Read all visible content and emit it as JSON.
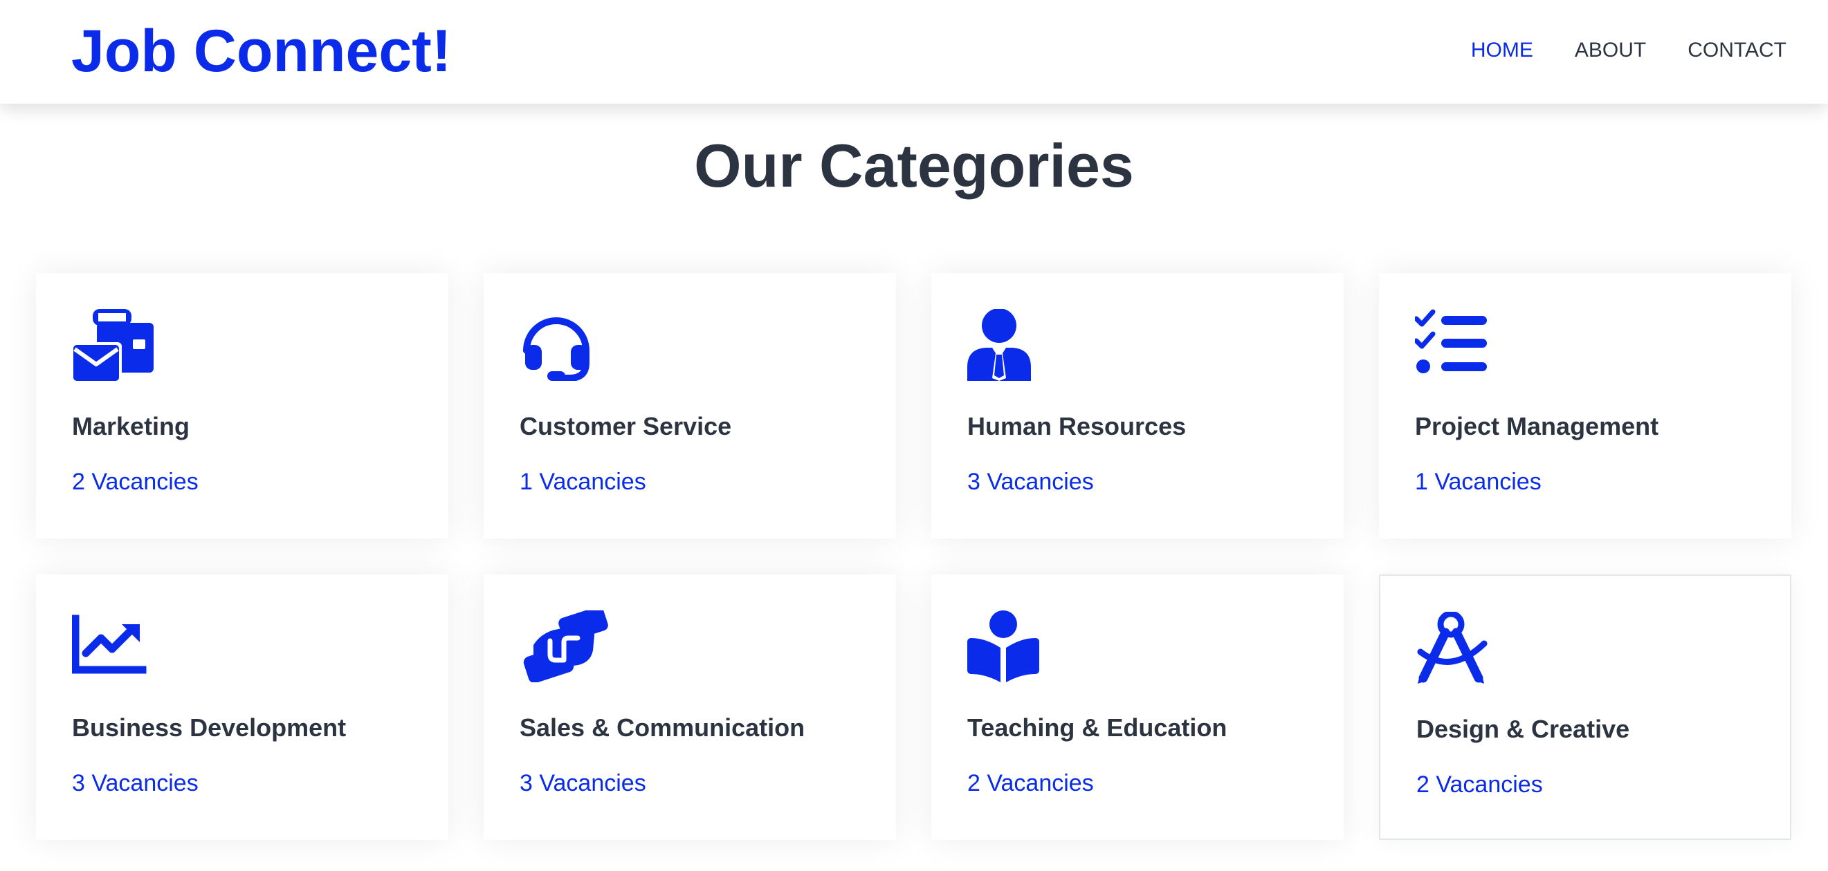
{
  "brand": {
    "name": "Job Connect!"
  },
  "nav": {
    "items": [
      {
        "label": "HOME",
        "active": true
      },
      {
        "label": "ABOUT",
        "active": false
      },
      {
        "label": "CONTACT",
        "active": false
      }
    ]
  },
  "section": {
    "title": "Our Categories"
  },
  "categories": [
    {
      "icon": "envelope-briefcase-icon",
      "title": "Marketing",
      "vacancies": "2 Vacancies"
    },
    {
      "icon": "headset-icon",
      "title": "Customer Service",
      "vacancies": "1 Vacancies"
    },
    {
      "icon": "user-tie-icon",
      "title": "Human Resources",
      "vacancies": "3 Vacancies"
    },
    {
      "icon": "list-check-icon",
      "title": "Project Management",
      "vacancies": "1 Vacancies"
    },
    {
      "icon": "chart-line-icon",
      "title": "Business Development",
      "vacancies": "3 Vacancies"
    },
    {
      "icon": "handshake-icon",
      "title": "Sales & Communication",
      "vacancies": "3 Vacancies"
    },
    {
      "icon": "book-reader-icon",
      "title": "Teaching & Education",
      "vacancies": "2 Vacancies"
    },
    {
      "icon": "compass-drafting-icon",
      "title": "Design & Creative",
      "vacancies": "2 Vacancies"
    }
  ],
  "colors": {
    "accent": "#0a2bea",
    "text": "#2b3440",
    "background": "#ffffff"
  }
}
